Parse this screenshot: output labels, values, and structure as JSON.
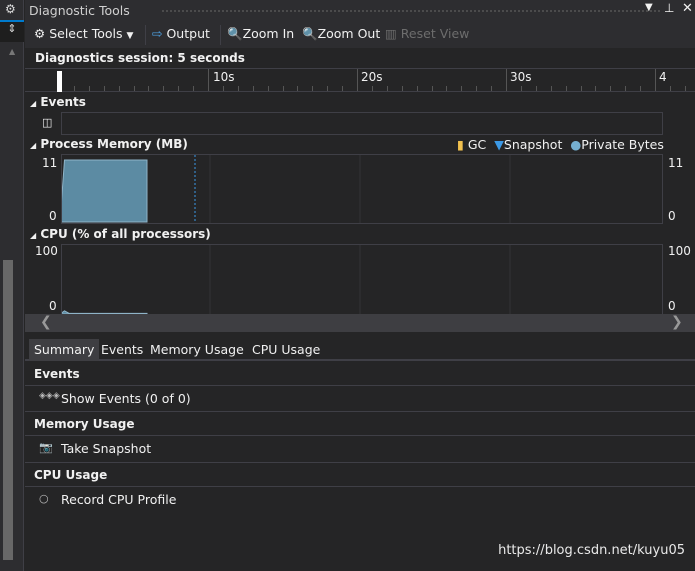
{
  "window": {
    "title": "Diagnostic Tools"
  },
  "toolbar": {
    "select_tools": "Select Tools",
    "output": "Output",
    "zoom_in": "Zoom In",
    "zoom_out": "Zoom Out",
    "reset_view": "Reset View"
  },
  "session": {
    "label": "Diagnostics session: 5 seconds"
  },
  "ruler": {
    "ticks": [
      "10s",
      "20s",
      "30s",
      "4"
    ]
  },
  "events_section": {
    "title": "Events"
  },
  "memory_section": {
    "title": "Process Memory (MB)",
    "legend": {
      "gc": "GC",
      "snapshot": "Snapshot",
      "private_bytes": "Private Bytes"
    },
    "y_max": "11",
    "y_min": "0"
  },
  "cpu_section": {
    "title": "CPU (% of all processors)",
    "y_max": "100",
    "y_min": "0"
  },
  "chart_data": [
    {
      "type": "area",
      "title": "Process Memory (MB)",
      "xlim": [
        0,
        40
      ],
      "ylim": [
        0,
        11
      ],
      "x": [
        0,
        0.3,
        5.8,
        5.8
      ],
      "y": [
        0,
        11,
        11,
        0
      ],
      "marker_time": 9
    },
    {
      "type": "area",
      "title": "CPU (% of all processors)",
      "xlim": [
        0,
        40
      ],
      "ylim": [
        0,
        100
      ],
      "x": [
        0,
        0.3,
        0.6,
        5.8
      ],
      "y": [
        0,
        5,
        1,
        1
      ]
    }
  ],
  "tabs": [
    {
      "label": "Summary",
      "selected": true
    },
    {
      "label": "Events"
    },
    {
      "label": "Memory Usage"
    },
    {
      "label": "CPU Usage"
    }
  ],
  "summary": {
    "events": {
      "header": "Events",
      "action": "Show Events (0 of 0)"
    },
    "memory": {
      "header": "Memory Usage",
      "action": "Take Snapshot"
    },
    "cpu": {
      "header": "CPU Usage",
      "action": "Record CPU Profile"
    }
  },
  "colors": {
    "area": "#5c8ba3",
    "snapshot": "#3c99e6",
    "gc": "#f2c14e",
    "private_bytes": "#75afd0"
  },
  "watermark": "https://blog.csdn.net/kuyu05"
}
